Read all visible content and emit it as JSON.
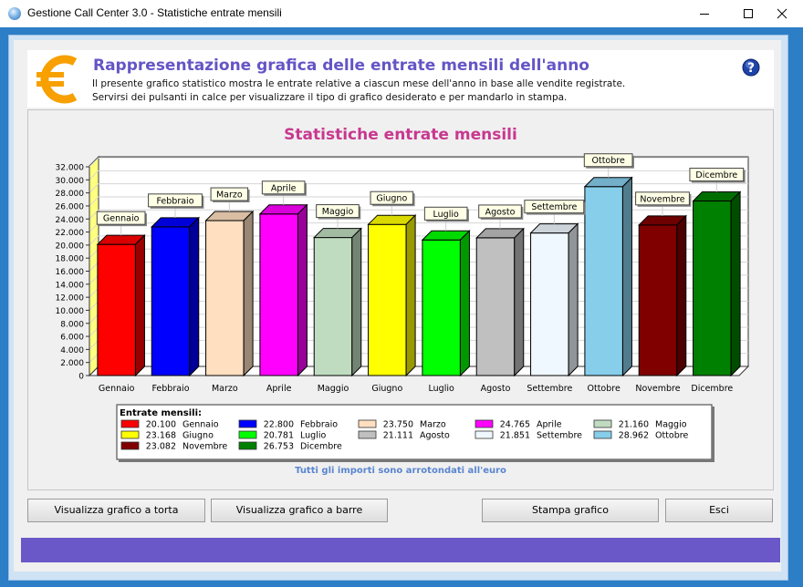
{
  "window": {
    "title": "Gestione Call Center 3.0 - Statistiche entrate mensili"
  },
  "header": {
    "heading": "Rappresentazione grafica delle entrate mensili dell'anno",
    "desc_line1": "Il presente grafico statistico mostra le entrate relative a ciascun mese dell'anno in base alle vendite registrate.",
    "desc_line2": "Servirsi dei pulsanti in calce per visualizzare il tipo di grafico desiderato e per mandarlo in stampa.",
    "icon": "euro-icon",
    "help_icon": "help-icon"
  },
  "chart_data": {
    "type": "bar",
    "title": "Statistiche entrate mensili",
    "xlabel": "",
    "ylabel": "",
    "ylim": [
      0,
      32000
    ],
    "yticks": [
      "0",
      "2.000",
      "4.000",
      "6.000",
      "8.000",
      "10.000",
      "12.000",
      "14.000",
      "16.000",
      "18.000",
      "20.000",
      "22.000",
      "24.000",
      "26.000",
      "28.000",
      "30.000",
      "32.000"
    ],
    "grid": true,
    "legend_position": "bottom",
    "legend_title": "Entrate mensili:",
    "footnote": "Tutti gli importi sono arrotondati all'euro",
    "categories": [
      "Gennaio",
      "Febbraio",
      "Marzo",
      "Aprile",
      "Maggio",
      "Giugno",
      "Luglio",
      "Agosto",
      "Settembre",
      "Ottobre",
      "Novembre",
      "Dicembre"
    ],
    "values": [
      20100,
      22800,
      23750,
      24765,
      21160,
      23168,
      20781,
      21111,
      21851,
      28962,
      23082,
      26753
    ],
    "value_labels": [
      "20.100",
      "22.800",
      "23.750",
      "24.765",
      "21.160",
      "23.168",
      "20.781",
      "21.111",
      "21.851",
      "28.962",
      "23.082",
      "26.753"
    ],
    "colors": [
      "#ff0000",
      "#0000ff",
      "#ffdfc0",
      "#ff00ff",
      "#c0dcc0",
      "#ffff00",
      "#00ff00",
      "#c0c0c0",
      "#f0f8ff",
      "#87ceeb",
      "#800000",
      "#008000"
    ]
  },
  "buttons": {
    "pie": "Visualizza grafico a torta",
    "bars": "Visualizza grafico a barre",
    "print": "Stampa grafico",
    "exit": "Esci"
  }
}
